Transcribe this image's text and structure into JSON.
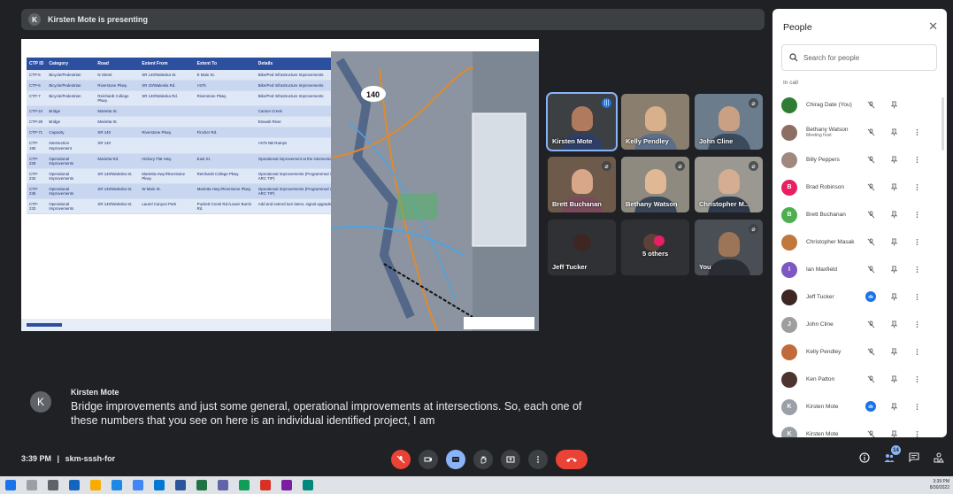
{
  "presenter_bar": {
    "avatar_initial": "K",
    "text": "Kirsten Mote is presenting"
  },
  "slide": {
    "table_headers": [
      "CTP ID",
      "Category",
      "Road",
      "Extent From",
      "Extent To",
      "Details"
    ],
    "rows": [
      [
        "CTP-5",
        "Bicycle/Pedestrian",
        "N Street",
        "SR 140/Waleska St.",
        "E Main St.",
        "Bike/Ped Infrastructure Improvements"
      ],
      [
        "CTP-6",
        "Bicycle/Pedestrian",
        "Riverstone Pkwy.",
        "SR 20/Waleska Rd.",
        "I-575",
        "Bike/Ped Infrastructure Improvements"
      ],
      [
        "CTP-7",
        "Bicycle/Pedestrian",
        "Reinhardt College Pkwy.",
        "SR 140/Waleska Rd.",
        "Riverstone Pkwy.",
        "Bike/Ped Infrastructure Improvements"
      ],
      [
        "CTP-24",
        "Bridge",
        "Marietta St.",
        "",
        "",
        "Canton Creek"
      ],
      [
        "CTP-28",
        "Bridge",
        "Marietta St.",
        "",
        "",
        "Etowah River"
      ],
      [
        "CTP-71",
        "Capacity",
        "SR 140",
        "Riverstone Pkwy.",
        "Fincher Rd.",
        ""
      ],
      [
        "CTP-190",
        "Intersection Improvement",
        "SR 140",
        "",
        "",
        "I-575 NB Ramps"
      ],
      [
        "CTP-229",
        "Operational Improvements",
        "Marietta Rd.",
        "Hickory Flat Hwy.",
        "East St.",
        "Operational improvement at the intersection"
      ],
      [
        "CTP-234",
        "Operational Improvements",
        "SR 140/Waleska St.",
        "Marietta Hwy./Riverstone Pkwy.",
        "Reinhardt College Pkwy.",
        "Operational Improvements (Programmed in ARC TIP)"
      ],
      [
        "CTP-236",
        "Operational Improvements",
        "SR 140/Waleska St.",
        "W Main St.",
        "Marietta Hwy./Riverstone Pkwy.",
        "Operational Improvements (Programmed in ARC TIP)"
      ],
      [
        "CTP-233",
        "Operational Improvements",
        "SR 140/Waleska St.",
        "Laurel Canyon Park",
        "Puckett Creek Rd./Lower Burris Rd.",
        "Add and extend turn lanes, signal upgrade"
      ]
    ]
  },
  "tiles": [
    {
      "name": "Kirsten Mote",
      "badge": "|||"
    },
    {
      "name": "Kelly Pendley",
      "badge": ""
    },
    {
      "name": "John Cline",
      "badge": "⌀"
    },
    {
      "name": "Brett Buchanan",
      "badge": "⌀"
    },
    {
      "name": "Bethany Watson",
      "badge": "⌀"
    },
    {
      "name": "Christopher M...",
      "badge": "⌀"
    },
    {
      "name": "Jeff Tucker",
      "badge": ""
    },
    {
      "name": "5 others",
      "badge": ""
    },
    {
      "name": "You",
      "badge": "⌀"
    }
  ],
  "caption": {
    "avatar_initial": "K",
    "speaker": "Kirsten Mote",
    "text": "Bridge improvements and just some general, operational improvements at intersections. So, each one of these numbers that you see on here is an individual identified project, I am"
  },
  "meeting": {
    "time": "3:39 PM",
    "separator": "|",
    "code": "skm-sssh-for"
  },
  "participants_count": "14",
  "people": {
    "title": "People",
    "search_placeholder": "Search for people",
    "section_label": "In call",
    "list": [
      {
        "name": "Chirag Date (You)",
        "sub": "",
        "initial": "",
        "color": "#2e7d32"
      },
      {
        "name": "Bethany Watson",
        "sub": "Meeting host",
        "initial": "",
        "color": "#8d6e63"
      },
      {
        "name": "Billy Peppers",
        "sub": "",
        "initial": "",
        "color": "#a1887f"
      },
      {
        "name": "Brad Robinson",
        "sub": "",
        "initial": "B",
        "color": "#e91e63"
      },
      {
        "name": "Brett Buchanan",
        "sub": "",
        "initial": "B",
        "color": "#4caf50"
      },
      {
        "name": "Christopher Masak",
        "sub": "",
        "initial": "",
        "color": "#c0783c"
      },
      {
        "name": "Ian Maxfield",
        "sub": "",
        "initial": "I",
        "color": "#7e57c2"
      },
      {
        "name": "Jeff Tucker",
        "sub": "",
        "initial": "",
        "color": "#3e2723"
      },
      {
        "name": "John Cline",
        "sub": "",
        "initial": "J",
        "color": "#9e9e9e"
      },
      {
        "name": "Kelly Pendley",
        "sub": "",
        "initial": "",
        "color": "#bf6b3a"
      },
      {
        "name": "Ken Patton",
        "sub": "",
        "initial": "",
        "color": "#4e342e"
      },
      {
        "name": "Kirsten Mote",
        "sub": "",
        "initial": "K",
        "color": "#9aa0a6"
      },
      {
        "name": "Kirsten Mote",
        "sub": "",
        "initial": "K",
        "color": "#9aa0a6"
      }
    ]
  },
  "taskbar": {
    "time": "3:39 PM",
    "date": "8/30/2022"
  }
}
